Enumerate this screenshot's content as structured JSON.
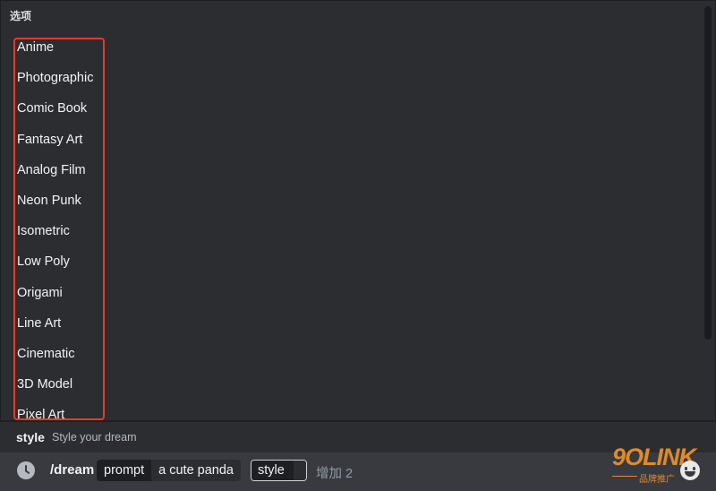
{
  "popup": {
    "title": "选项",
    "options": [
      "Anime",
      "Photographic",
      "Comic Book",
      "Fantasy Art",
      "Analog Film",
      "Neon Punk",
      "Isometric",
      "Low Poly",
      "Origami",
      "Line Art",
      "Cinematic",
      "3D Model",
      "Pixel Art"
    ]
  },
  "hint": {
    "name": "style",
    "description": "Style your dream"
  },
  "command": {
    "name": "/dream",
    "prompt_key": "prompt",
    "prompt_value": "a cute panda",
    "style_key": "style",
    "more_label": "增加 2"
  },
  "watermark": {
    "logo": "9OLINK",
    "tagline": "品牌推广"
  },
  "icons": {
    "history": "clock-icon",
    "emoji": "emoji-icon"
  },
  "colors": {
    "highlight_border": "#e53b2c",
    "panel": "#2b2d31",
    "input_bar": "#383a40"
  }
}
